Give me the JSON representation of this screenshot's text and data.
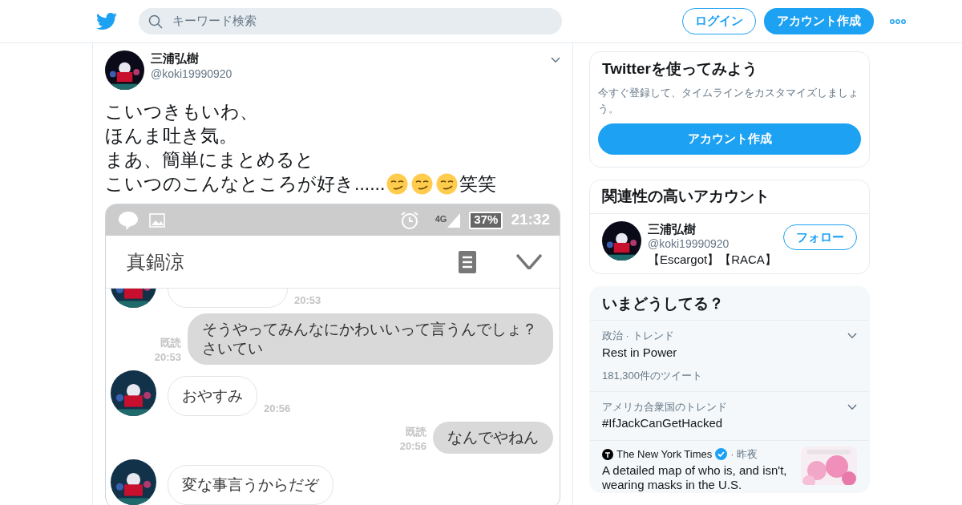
{
  "header": {
    "search": {
      "placeholder": "キーワード検索"
    },
    "login": "ログイン",
    "signup": "アカウント作成"
  },
  "tweet": {
    "name": "三浦弘樹",
    "handle": "@koki19990920",
    "lines": [
      [
        {
          "kind": "text",
          "text": "こいつきもいわ、"
        }
      ],
      [
        {
          "kind": "text",
          "text": "ほんま吐き気。"
        }
      ],
      [
        {
          "kind": "text",
          "text": "まあ、簡単にまとめると"
        }
      ],
      [
        {
          "kind": "text",
          "text": "こいつのこんなところが好き......"
        },
        {
          "kind": "emoji"
        },
        {
          "kind": "emoji"
        },
        {
          "kind": "emoji"
        },
        {
          "kind": "text",
          "text": "笑笑"
        }
      ]
    ],
    "screenshot": {
      "network": "4G",
      "battery": "37%",
      "time": "21:32",
      "contact": "真鍋涼",
      "messages": [
        {
          "kind": "incoming",
          "time": "20:53"
        },
        {
          "kind": "outgoing",
          "text": "そうやってみんなにかわいいって言うんでしょ？さいてい",
          "read": "既読",
          "time": "20:53"
        },
        {
          "kind": "incoming",
          "text": "おやすみ",
          "time": "20:56"
        },
        {
          "kind": "outgoing",
          "text": "なんでやねん",
          "read": "既読",
          "time": "20:56"
        },
        {
          "kind": "incoming",
          "text": "変な事言うからだぞ"
        }
      ]
    }
  },
  "signup_card": {
    "title": "Twitterを使ってみよう",
    "description": "今すぐ登録して、タイムラインをカスタマイズしましょう。",
    "button": "アカウント作成"
  },
  "related": {
    "title": "関連性の高いアカウント",
    "accounts": [
      {
        "name": "三浦弘樹",
        "handle": "@koki19990920",
        "bio": "【Escargot】【RACA】",
        "button": "フォロー"
      }
    ]
  },
  "trends": {
    "title": "いまどうしてる？",
    "items": [
      {
        "kind": "trend",
        "meta": "政治 · トレンド",
        "name": "Rest in Power",
        "count": "181,300件のツイート"
      },
      {
        "kind": "trend",
        "meta": "アメリカ合衆国のトレンド",
        "name": "#IfJackCanGetHacked"
      },
      {
        "kind": "news",
        "source": "The New York Times",
        "verified": true,
        "meta": "· 昨夜",
        "name": "A detailed map of who is, and isn't, wearing masks in the U.S."
      }
    ]
  }
}
